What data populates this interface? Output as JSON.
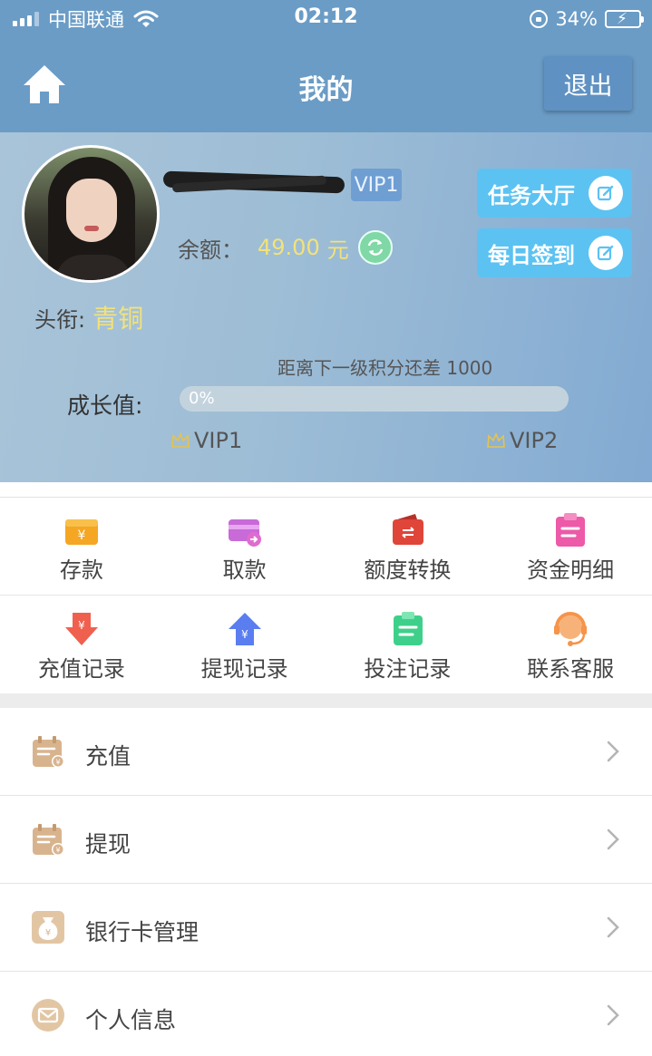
{
  "status_bar": {
    "carrier": "中国联通",
    "time": "02:12",
    "battery_percent": "34%",
    "battery_level": 0.34,
    "icons": [
      "signal-icon",
      "wifi-icon",
      "rotation-lock-icon",
      "battery-charging-icon"
    ]
  },
  "nav": {
    "title": "我的",
    "logout_label": "退出",
    "home_icon": "home-icon"
  },
  "profile": {
    "vip_badge": "VIP1",
    "balance_label": "余额：",
    "balance_amount": "49.00",
    "balance_unit": "元",
    "task_hall_label": "任务大厅",
    "daily_sign_label": "每日签到",
    "title_label": "头衔:",
    "title_value": "青铜",
    "next_level_text": "距离下一级积分还差 1000",
    "growth_label": "成长值:",
    "growth_percent": "0%",
    "growth_fraction": 0,
    "current_level": "VIP1",
    "next_level": "VIP2"
  },
  "grid": {
    "row1": [
      {
        "label": "存款",
        "icon": "deposit-icon",
        "color": "#f5a623"
      },
      {
        "label": "取款",
        "icon": "withdraw-card-icon",
        "color": "#c86ad8"
      },
      {
        "label": "额度转换",
        "icon": "transfer-wallet-icon",
        "color": "#e0453a"
      },
      {
        "label": "资金明细",
        "icon": "funds-detail-icon",
        "color": "#ec5aa8"
      }
    ],
    "row2": [
      {
        "label": "充值记录",
        "icon": "recharge-record-icon",
        "color": "#f0604f"
      },
      {
        "label": "提现记录",
        "icon": "withdraw-record-icon",
        "color": "#5a7df0"
      },
      {
        "label": "投注记录",
        "icon": "bet-record-icon",
        "color": "#3ed08a"
      },
      {
        "label": "联系客服",
        "icon": "customer-service-icon",
        "color": "#f5944a"
      }
    ]
  },
  "list": [
    {
      "label": "充值",
      "icon": "recharge-icon"
    },
    {
      "label": "提现",
      "icon": "withdraw-icon"
    },
    {
      "label": "银行卡管理",
      "icon": "bank-card-icon"
    },
    {
      "label": "个人信息",
      "icon": "personal-info-icon"
    }
  ],
  "colors": {
    "header_blue": "#6a9cc6",
    "accent_yellow": "#f3e27a",
    "button_cyan": "#5cc2f2"
  }
}
